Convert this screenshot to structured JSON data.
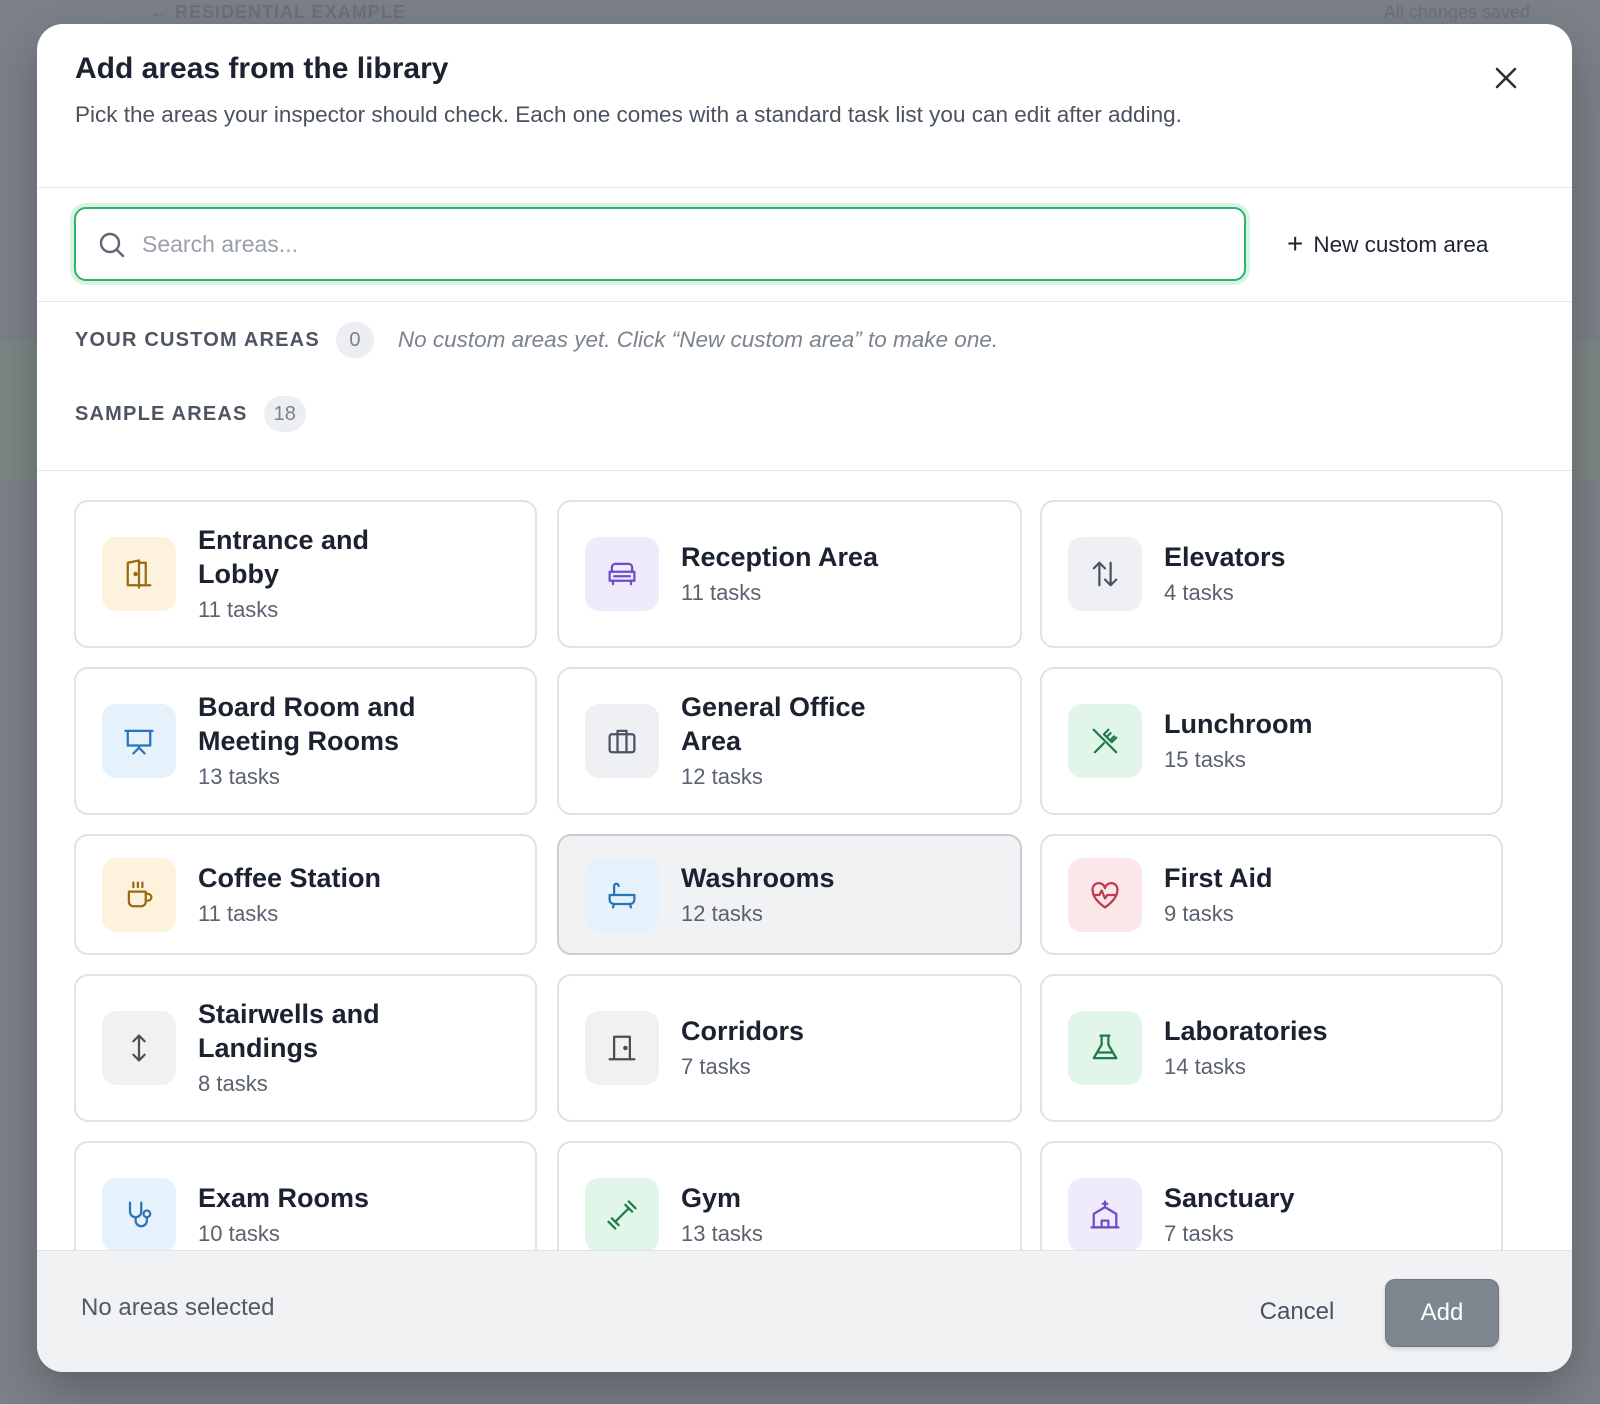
{
  "background": {
    "breadcrumb": "← RESIDENTIAL EXAMPLE",
    "status": "All changes saved"
  },
  "modal": {
    "title": "Add areas from the library",
    "subtitle": "Pick the areas your inspector should check. Each one comes with a standard task list you can edit after adding.",
    "close_icon": "close-icon"
  },
  "search": {
    "placeholder": "Search areas...",
    "value": "",
    "new_custom_label": "New custom area"
  },
  "custom_section": {
    "label": "YOUR CUSTOM AREAS",
    "count": "0",
    "empty": "No custom areas yet. Click “New custom area” to make one."
  },
  "sample_section": {
    "label": "SAMPLE AREAS",
    "count": "18"
  },
  "areas": [
    {
      "name": "Entrance and Lobby",
      "tasks": "11 tasks",
      "icon": "door-icon",
      "color": "#9a6a12",
      "bg": "#fdf3dc"
    },
    {
      "name": "Reception Area",
      "tasks": "11 tasks",
      "icon": "sofa-icon",
      "color": "#6b4fc9",
      "bg": "#efebfb"
    },
    {
      "name": "Elevators",
      "tasks": "4 tasks",
      "icon": "arrows-up-down-icon",
      "color": "#4a5364",
      "bg": "#eef0f4"
    },
    {
      "name": "Board Room and Meeting Rooms",
      "tasks": "13 tasks",
      "icon": "presentation-icon",
      "color": "#2a73b8",
      "bg": "#e5f1fb"
    },
    {
      "name": "General Office Area",
      "tasks": "12 tasks",
      "icon": "briefcase-icon",
      "color": "#4a5364",
      "bg": "#eef0f4"
    },
    {
      "name": "Lunchroom",
      "tasks": "15 tasks",
      "icon": "utensils-icon",
      "color": "#1e7a4a",
      "bg": "#e1f5e9"
    },
    {
      "name": "Coffee Station",
      "tasks": "11 tasks",
      "icon": "coffee-icon",
      "color": "#9a6a12",
      "bg": "#fdf3dc"
    },
    {
      "name": "Washrooms",
      "tasks": "12 tasks",
      "icon": "bathtub-icon",
      "color": "#2a73b8",
      "bg": "#e5f1fb"
    },
    {
      "name": "First Aid",
      "tasks": "9 tasks",
      "icon": "heart-pulse-icon",
      "color": "#c23a4a",
      "bg": "#fbe7ea"
    },
    {
      "name": "Stairwells and Landings",
      "tasks": "8 tasks",
      "icon": "arrow-up-down-icon",
      "color": "#4a4f57",
      "bg": "#f1f1ef"
    },
    {
      "name": "Corridors",
      "tasks": "7 tasks",
      "icon": "door-closed-icon",
      "color": "#4a4f57",
      "bg": "#f1f1ef"
    },
    {
      "name": "Laboratories",
      "tasks": "14 tasks",
      "icon": "flask-icon",
      "color": "#1e7a4a",
      "bg": "#e1f5e9"
    },
    {
      "name": "Exam Rooms",
      "tasks": "10 tasks",
      "icon": "stethoscope-icon",
      "color": "#2a73b8",
      "bg": "#e5f1fb"
    },
    {
      "name": "Gym",
      "tasks": "13 tasks",
      "icon": "dumbbell-icon",
      "color": "#1e7a4a",
      "bg": "#e1f5e9"
    },
    {
      "name": "Sanctuary",
      "tasks": "7 tasks",
      "icon": "church-icon",
      "color": "#6b4fc9",
      "bg": "#efebfb"
    }
  ],
  "footer": {
    "selection": "No areas selected",
    "cancel": "Cancel",
    "add": "Add"
  }
}
